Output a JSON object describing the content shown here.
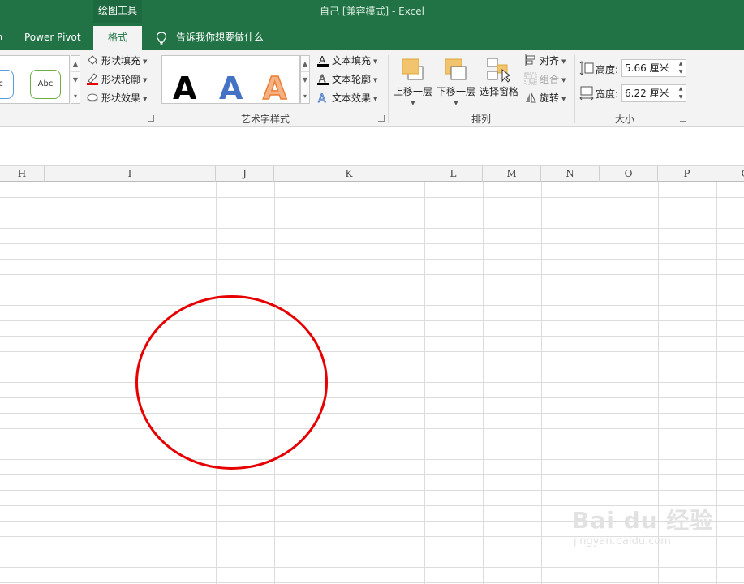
{
  "titlebar": {
    "context_group": "绘图工具",
    "window_title": "自己  [兼容模式]  -  Excel"
  },
  "tabs": {
    "power_pivot": "Power Pivot",
    "format": "格式",
    "tell_me": "告诉我你想要做什么"
  },
  "ribbon": {
    "shape_styles": {
      "sample_1": "bc",
      "sample_2": "Abc",
      "fill": "形状填充",
      "outline": "形状轮廓",
      "effects": "形状效果"
    },
    "wordart": {
      "label": "艺术字样式",
      "sample_glyph": "A",
      "text_fill": "文本填充",
      "text_outline": "文本轮廓",
      "text_effects": "文本效果"
    },
    "arrange": {
      "label": "排列",
      "bring_forward": "上移一层",
      "send_backward": "下移一层",
      "selection_pane": "选择窗格",
      "align": "对齐",
      "group": "组合",
      "rotate": "旋转"
    },
    "size": {
      "label": "大小",
      "height_label": "高度:",
      "height_value": "5.66 厘米",
      "width_label": "宽度:",
      "width_value": "6.22 厘米"
    }
  },
  "sheet": {
    "columns": [
      "H",
      "I",
      "J",
      "K",
      "L",
      "M",
      "N",
      "O",
      "P",
      "Q"
    ]
  },
  "watermark": {
    "brand": "Bai du 经验",
    "url": "jingyan.baidu.com"
  },
  "colors": {
    "excel_green": "#217346",
    "shape_outline": "#e60000",
    "wordart_blue": "#4472c4",
    "wordart_orange": "#ed7d31"
  }
}
